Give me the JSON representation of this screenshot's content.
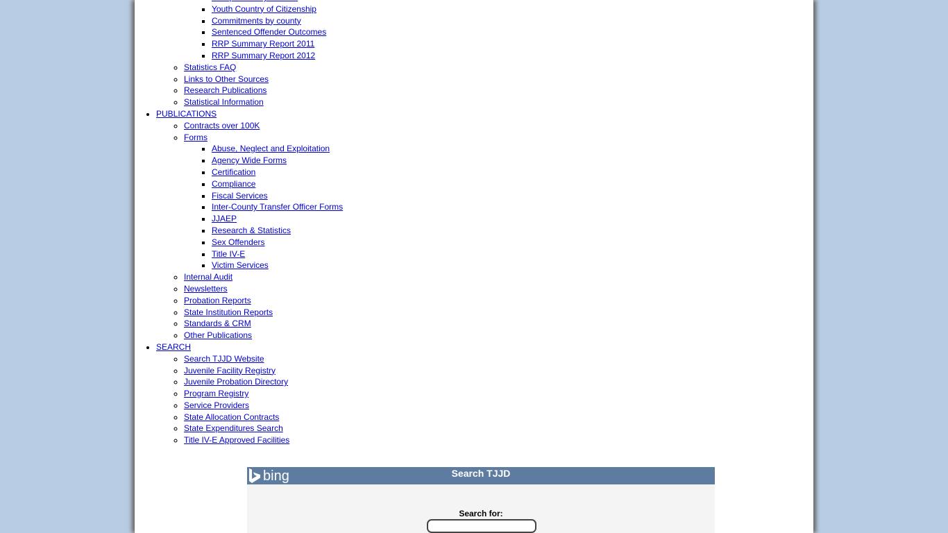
{
  "nav": {
    "items": [
      {
        "label": "",
        "children": [
          {
            "label": "",
            "children": [
              {
                "label": "Comparison by Gender"
              },
              {
                "label": "Youth Country of Citizenship"
              },
              {
                "label": "Commitments by county"
              },
              {
                "label": "Sentenced Offender Outcomes"
              },
              {
                "label": "RRP Summary Report 2011"
              },
              {
                "label": "RRP Summary Report 2012"
              }
            ]
          },
          {
            "label": "Statistics FAQ"
          },
          {
            "label": "Links to Other Sources"
          },
          {
            "label": "Research Publications"
          },
          {
            "label": "Statistical Information"
          }
        ]
      },
      {
        "label": "PUBLICATIONS",
        "children": [
          {
            "label": "Contracts over 100K"
          },
          {
            "label": "Forms",
            "children": [
              {
                "label": "Abuse, Neglect and Exploitation"
              },
              {
                "label": "Agency Wide Forms"
              },
              {
                "label": "Certification"
              },
              {
                "label": "Compliance"
              },
              {
                "label": "Fiscal Services"
              },
              {
                "label": "Inter-County Transfer Officer Forms"
              },
              {
                "label": "JJAEP"
              },
              {
                "label": "Research & Statistics"
              },
              {
                "label": "Sex Offenders"
              },
              {
                "label": "Title IV-E"
              },
              {
                "label": "Victim Services"
              }
            ]
          },
          {
            "label": "Internal Audit"
          },
          {
            "label": "Newsletters"
          },
          {
            "label": "Probation Reports"
          },
          {
            "label": "State Institution Reports"
          },
          {
            "label": "Standards & CRM"
          },
          {
            "label": "Other Publications"
          }
        ]
      },
      {
        "label": "SEARCH",
        "children": [
          {
            "label": "Search TJJD Website"
          },
          {
            "label": "Juvenile Facility Registry"
          },
          {
            "label": "Juvenile Probation Directory"
          },
          {
            "label": "Program Registry"
          },
          {
            "label": "Service Providers"
          },
          {
            "label": "State Allocation Contracts"
          },
          {
            "label": "State Expenditures Search"
          },
          {
            "label": "Title IV-E Approved Facilities"
          }
        ]
      }
    ]
  },
  "search": {
    "logo_text": "bing",
    "title": "Search TJJD",
    "label": "Search for:",
    "value": "",
    "icon": "bing-logo-icon"
  },
  "colors": {
    "background": "#b8cce4",
    "link": "#0000cc",
    "search_header": "#5e7c9f"
  }
}
